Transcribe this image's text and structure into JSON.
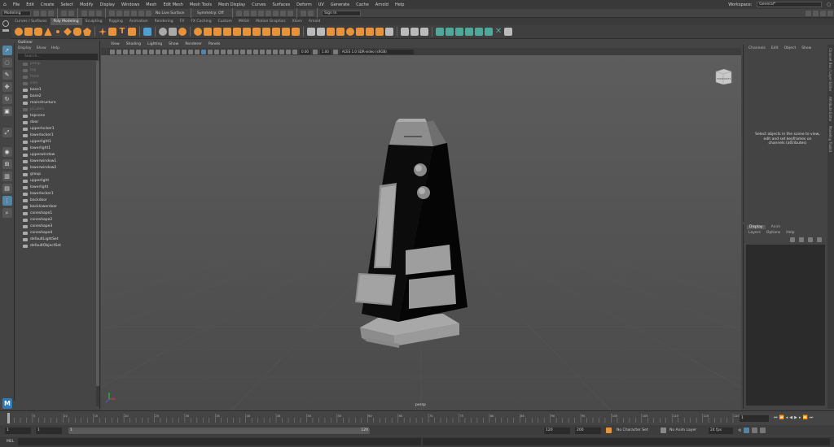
{
  "menubar": {
    "items": [
      "File",
      "Edit",
      "Create",
      "Select",
      "Modify",
      "Display",
      "Windows",
      "Mesh",
      "Edit Mesh",
      "Mesh Tools",
      "Mesh Display",
      "Curves",
      "Surfaces",
      "Deform",
      "UV",
      "Generate",
      "Cache",
      "Arnold",
      "Help"
    ],
    "workspace_label": "Workspace:",
    "workspace_value": "General*"
  },
  "statusline": {
    "mode": "Modeling",
    "live_surface": "No Live Surface",
    "symmetry": "Symmetry: Off",
    "signin": "Sign In"
  },
  "shelf": {
    "tabs": [
      "Curves / Surfaces",
      "Poly Modeling",
      "Sculpting",
      "Rigging",
      "Animation",
      "Rendering",
      "FX",
      "FX Caching",
      "Custom",
      "MASH",
      "Motion Graphics",
      "XGen",
      "Arnold"
    ],
    "active_tab": 1
  },
  "outliner": {
    "title": "Outliner",
    "menu": [
      "Display",
      "Show",
      "Help"
    ],
    "search_placeholder": "Search...",
    "items": [
      {
        "label": "persp",
        "dim": true
      },
      {
        "label": "top",
        "dim": true
      },
      {
        "label": "front",
        "dim": true
      },
      {
        "label": "side",
        "dim": true
      },
      {
        "label": "base1",
        "dim": false
      },
      {
        "label": "base2",
        "dim": false
      },
      {
        "label": "mainstructure",
        "dim": false
      },
      {
        "label": "pCube1",
        "dim": true
      },
      {
        "label": "topcone",
        "dim": false
      },
      {
        "label": "door",
        "dim": false
      },
      {
        "label": "upperlocker1",
        "dim": false
      },
      {
        "label": "lowerlocker1",
        "dim": false
      },
      {
        "label": "upperlight1",
        "dim": false
      },
      {
        "label": "lowerlight1",
        "dim": false
      },
      {
        "label": "upperwindow",
        "dim": false
      },
      {
        "label": "lowerwindow1",
        "dim": false
      },
      {
        "label": "lowerwindow2",
        "dim": false
      },
      {
        "label": "group",
        "dim": false
      },
      {
        "label": "upperlight",
        "dim": false
      },
      {
        "label": "lowerlight",
        "dim": false
      },
      {
        "label": "lowerlocker1",
        "dim": false
      },
      {
        "label": "backdoor",
        "dim": false
      },
      {
        "label": "backlowerdoor",
        "dim": false
      },
      {
        "label": "coneshape1",
        "dim": false
      },
      {
        "label": "coneshape2",
        "dim": false
      },
      {
        "label": "coneshape3",
        "dim": false
      },
      {
        "label": "coneshape4",
        "dim": false
      },
      {
        "label": "defaultLightSet",
        "dim": false
      },
      {
        "label": "defaultObjectSet",
        "dim": false
      }
    ]
  },
  "viewport": {
    "menu": [
      "View",
      "Shading",
      "Lighting",
      "Show",
      "Renderer",
      "Panels"
    ],
    "val1": "0.00",
    "val2": "1.00",
    "colorspace": "ACES 1.0 SDR-video (sRGB)",
    "camera_label": "persp",
    "viewcube_top": "TOP",
    "viewcube_front": "FRONT",
    "viewcube_side": "LEFT"
  },
  "channelbox": {
    "menu": [
      "Channels",
      "Edit",
      "Object",
      "Show"
    ],
    "message": "Select objects in the scene to view, edit and set keyframes on channels (attributes)"
  },
  "layers": {
    "tabs": [
      "Display",
      "Anim"
    ],
    "menu": [
      "Layers",
      "Options",
      "Help"
    ]
  },
  "sidetabs": [
    "Channel Box / Layer Editor",
    "Attribute Editor",
    "Modeling Toolkit"
  ],
  "timeslider": {
    "ticks": [
      "5",
      "10",
      "15",
      "20",
      "25",
      "30",
      "35",
      "40",
      "45",
      "50",
      "55",
      "60",
      "65",
      "70",
      "75",
      "80",
      "85",
      "90",
      "95",
      "100",
      "105",
      "110",
      "115",
      "120"
    ],
    "current_frame": "1"
  },
  "rangebar": {
    "start": "1",
    "start2": "1",
    "range_handle_start": "1",
    "range_handle_end": "120",
    "end": "120",
    "end2": "200",
    "character_set": "No Character Set",
    "anim_layer": "No Anim Layer",
    "fps": "24 fps"
  },
  "cmdline": {
    "label": "MEL"
  },
  "colors": {
    "accent": "#5285a6",
    "shelf_orange": "#e8923a",
    "shelf_teal": "#4fa89a"
  }
}
